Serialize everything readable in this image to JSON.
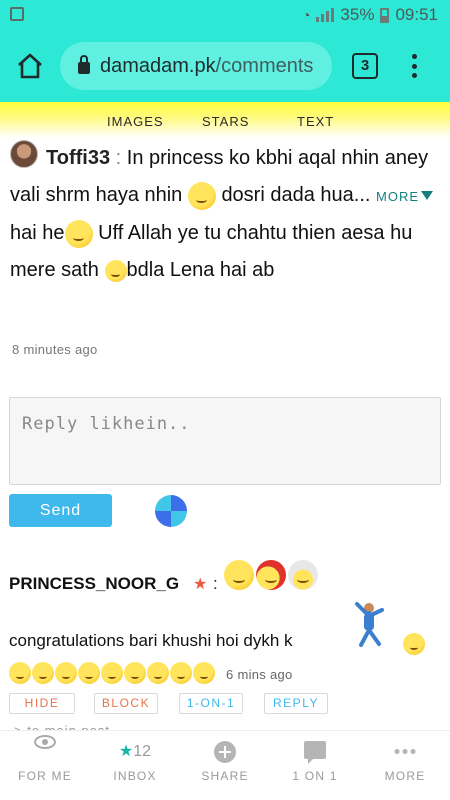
{
  "status_bar": {
    "battery": "35%",
    "time": "09:51"
  },
  "browser": {
    "url_host": "damadam.pk",
    "url_path": "/comments",
    "tab_count": "3"
  },
  "site_nav": {
    "images": "IMAGES",
    "stars": "STARS",
    "text": "TEXT"
  },
  "comment1": {
    "username": "Toffi33",
    "sep": ":",
    "part1": "In princess ko kbhi aqal nhin aney vali shrm haya nhin",
    "part2": "dosri dada hua...",
    "more": "MORE",
    "part3": "hai he",
    "part4": "Uff Allah ye tu chahtu thien aesa hu mere sath",
    "part5": "bdla Lena hai ab",
    "time": "8 minutes ago"
  },
  "reply": {
    "placeholder": "Reply likhein..",
    "send": "Send"
  },
  "comment2": {
    "username": "PRINCESS_NOOR_G",
    "colon": ":",
    "text": "congratulations bari khushi hoi dykh k",
    "time": "6 mins ago",
    "actions": {
      "hide": "HIDE",
      "block": "BLOCK",
      "one_on_one": "1-ON-1",
      "reply": "REPLY"
    },
    "to_main_post": "> to main post"
  },
  "bottom_nav": {
    "for_me": "FOR ME",
    "inbox_count": "12",
    "inbox": "INBOX",
    "share": "SHARE",
    "one_on_one": "1 ON 1",
    "more": "MORE"
  },
  "colors": {
    "accent": "#2de8d4",
    "nav_yellow": "#ffff3b",
    "send": "#3fb8ec",
    "action_orange": "#e8734a"
  }
}
